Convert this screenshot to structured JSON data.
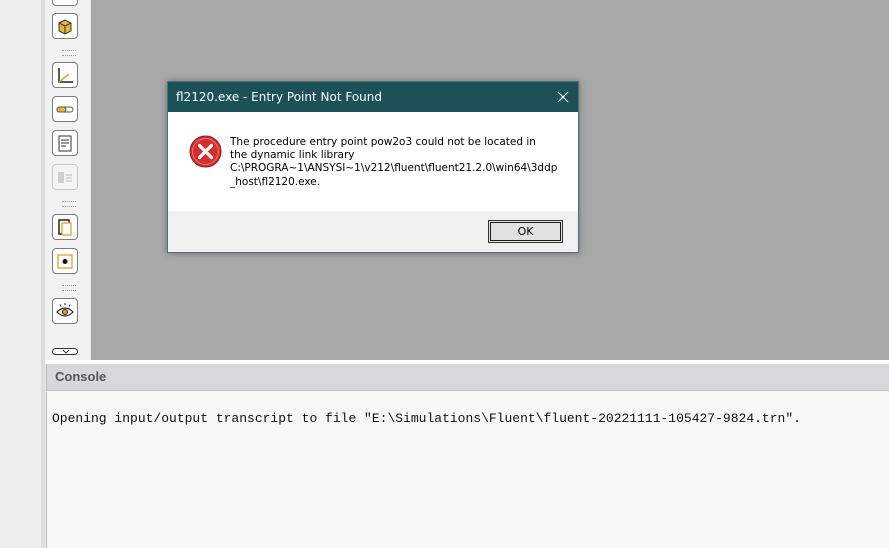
{
  "dialog": {
    "title": "fl2120.exe - Entry Point Not Found",
    "message_lines": [
      "The procedure entry point pow2o3 could not be located in",
      "the dynamic link library",
      "C:\\PROGRA~1\\ANSYSI~1\\v212\\fluent\\fluent21.2.0\\win64\\3ddp",
      "_host\\fl2120.exe."
    ],
    "ok_label": "OK",
    "error_icon": "error-icon"
  },
  "console": {
    "title": "Console",
    "lines": [
      "Opening input/output transcript to file \"E:\\Simulations\\Fluent\\fluent-20221111-105427-9824.trn\"."
    ]
  },
  "toolbar": {
    "tools": [
      "view-cube-icon",
      "axes-icon",
      "slider-icon",
      "notes-icon",
      "disabled-list-icon",
      "copy-page-icon",
      "snapshot-icon",
      "eye-icon",
      "scroll-down-icon"
    ]
  },
  "colors": {
    "titlebar": "#1b5157",
    "graphics_bg": "#a8a8a8",
    "error_red": "#d32f2f"
  }
}
